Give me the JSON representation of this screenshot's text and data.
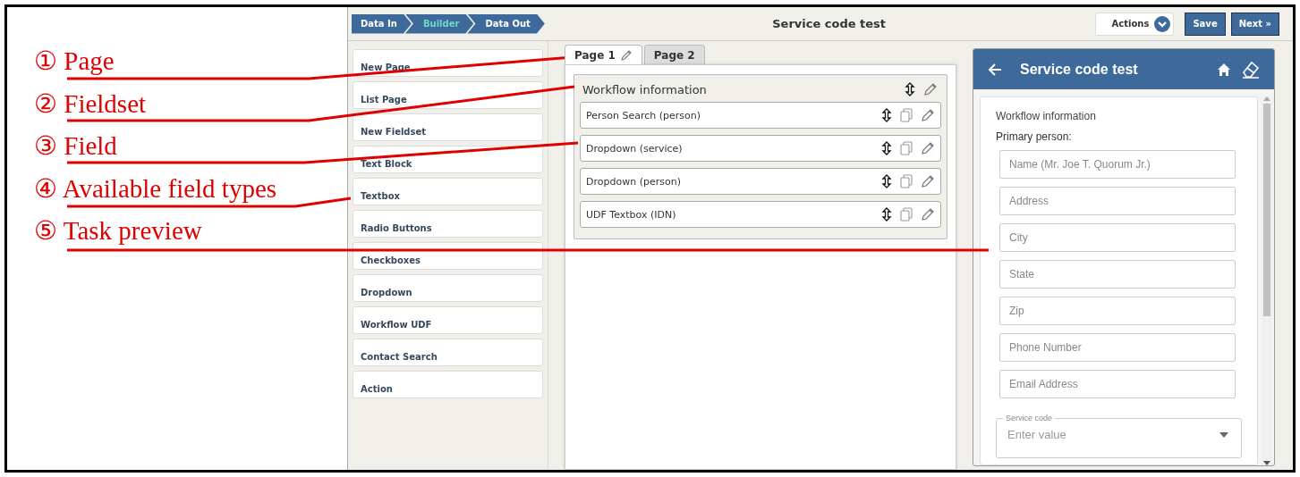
{
  "annotations": [
    {
      "label": "① Page"
    },
    {
      "label": "② Fieldset"
    },
    {
      "label": "③ Field"
    },
    {
      "label": "④ Available field types"
    },
    {
      "label": "⑤ Task preview"
    }
  ],
  "breadcrumb": [
    {
      "label": "Data In",
      "selected": false
    },
    {
      "label": "Builder",
      "selected": true
    },
    {
      "label": "Data Out",
      "selected": false
    }
  ],
  "title": "Service code test",
  "actions_button": "Actions",
  "save_button": "Save",
  "next_button": "Next »",
  "field_types": [
    "New Page",
    "List Page",
    "New Fieldset",
    "Text Block",
    "Textbox",
    "Radio Buttons",
    "Checkboxes",
    "Dropdown",
    "Workflow UDF",
    "Contact Search",
    "Action"
  ],
  "page_tabs": [
    {
      "label": "Page 1",
      "selected": true
    },
    {
      "label": "Page 2",
      "selected": false
    }
  ],
  "fieldset": {
    "title": "Workflow information",
    "fields": [
      "Person Search (person)",
      "Dropdown (service)",
      "Dropdown (person)",
      "UDF Textbox (IDN)"
    ]
  },
  "preview": {
    "title": "Service code test",
    "section": "Workflow information",
    "group_label": "Primary person:",
    "inputs": [
      {
        "placeholder": "Name (Mr. Joe T. Quorum Jr.)"
      },
      {
        "placeholder": "Address"
      },
      {
        "placeholder": "City"
      },
      {
        "placeholder": "State"
      },
      {
        "placeholder": "Zip"
      },
      {
        "placeholder": "Phone Number"
      },
      {
        "placeholder": "Email Address"
      }
    ],
    "select": {
      "label": "Service code",
      "placeholder": "Enter value"
    }
  }
}
